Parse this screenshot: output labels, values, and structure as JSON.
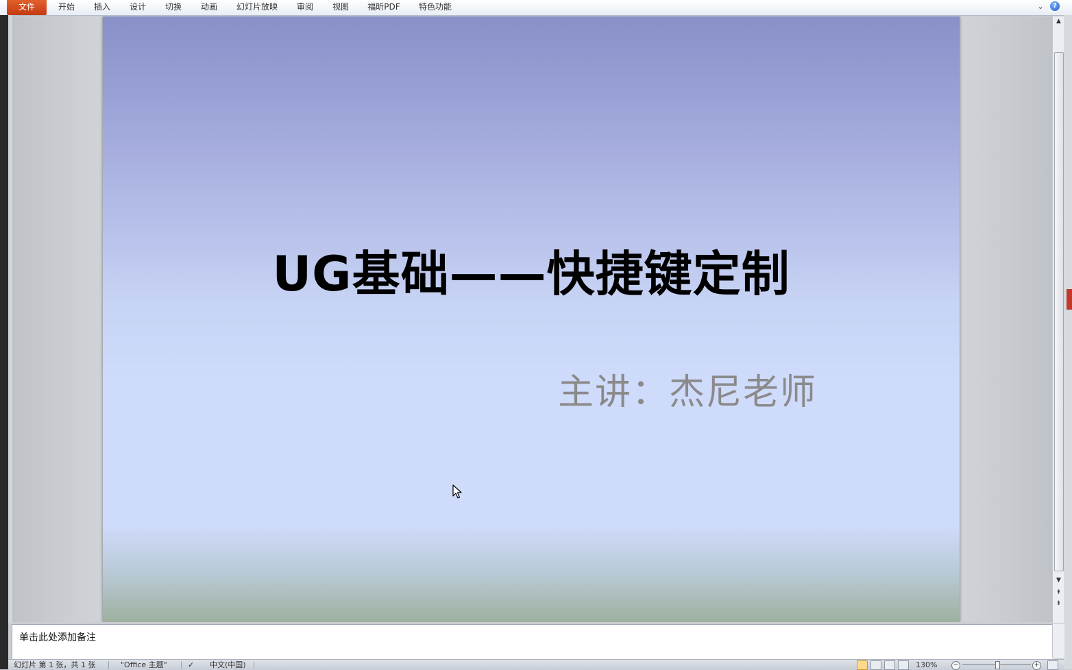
{
  "ribbon": {
    "tabs": [
      {
        "label": "文件"
      },
      {
        "label": "开始"
      },
      {
        "label": "插入"
      },
      {
        "label": "设计"
      },
      {
        "label": "切换"
      },
      {
        "label": "动画"
      },
      {
        "label": "幻灯片放映"
      },
      {
        "label": "审阅"
      },
      {
        "label": "视图"
      },
      {
        "label": "福昕PDF"
      },
      {
        "label": "特色功能"
      }
    ],
    "help_glyph": "?",
    "minimize_glyph": "⌄"
  },
  "slide": {
    "title": "UG基础——快捷键定制",
    "subtitle": "主讲：杰尼老师"
  },
  "notes": {
    "placeholder": "单击此处添加备注"
  },
  "status": {
    "slide_info": "幻灯片 第 1 张，共 1 张",
    "theme": "\"Office 主题\"",
    "language": "中文(中国)",
    "zoom": "130%"
  },
  "colors": {
    "file_tab": "#d2491b",
    "title_text": "#000000",
    "subtitle_text": "#8a8a8a"
  }
}
